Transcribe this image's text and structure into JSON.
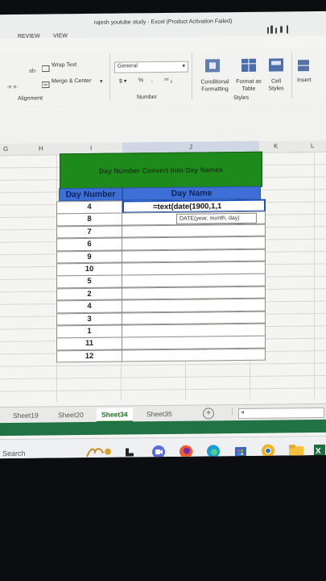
{
  "window": {
    "title": "rajesh youtube study - Excel (Product Activation Failed)",
    "tabs": [
      "REVIEW",
      "VIEW"
    ]
  },
  "ribbon": {
    "wrap_text": "Wrap Text",
    "merge_center": "Merge & Center",
    "alignment_label": "Alignment",
    "number_format": "General",
    "percent": "%",
    "comma": ",",
    "number_label": "Number",
    "conditional_formatting": "Conditional Formatting",
    "format_as_table": "Format as Table",
    "cell_styles": "Cell Styles",
    "styles_label": "Styles",
    "insert": "Insert"
  },
  "columns": [
    "G",
    "H",
    "I",
    "J",
    "K",
    "L"
  ],
  "sheet": {
    "banner": "Day Number Convert Into Day Names",
    "header_a": "Day Number",
    "header_b": "Day Name",
    "rows": [
      {
        "num": "4",
        "name": "=text(date(1900,1,1"
      },
      {
        "num": "8",
        "name": ""
      },
      {
        "num": "7",
        "name": ""
      },
      {
        "num": "6",
        "name": ""
      },
      {
        "num": "9",
        "name": ""
      },
      {
        "num": "10",
        "name": ""
      },
      {
        "num": "5",
        "name": ""
      },
      {
        "num": "2",
        "name": ""
      },
      {
        "num": "4",
        "name": ""
      },
      {
        "num": "3",
        "name": ""
      },
      {
        "num": "1",
        "name": ""
      },
      {
        "num": "11",
        "name": ""
      },
      {
        "num": "12",
        "name": ""
      }
    ],
    "tooltip": "DATE(year, month, day)"
  },
  "sheet_tabs": [
    "Sheet19",
    "Sheet20",
    "Sheet34",
    "Sheet35"
  ],
  "active_tab": "Sheet34",
  "taskbar": {
    "search": "Search"
  },
  "colors": {
    "banner": "#1f8a1c",
    "header": "#3d6fd6",
    "excel_green": "#217346"
  }
}
